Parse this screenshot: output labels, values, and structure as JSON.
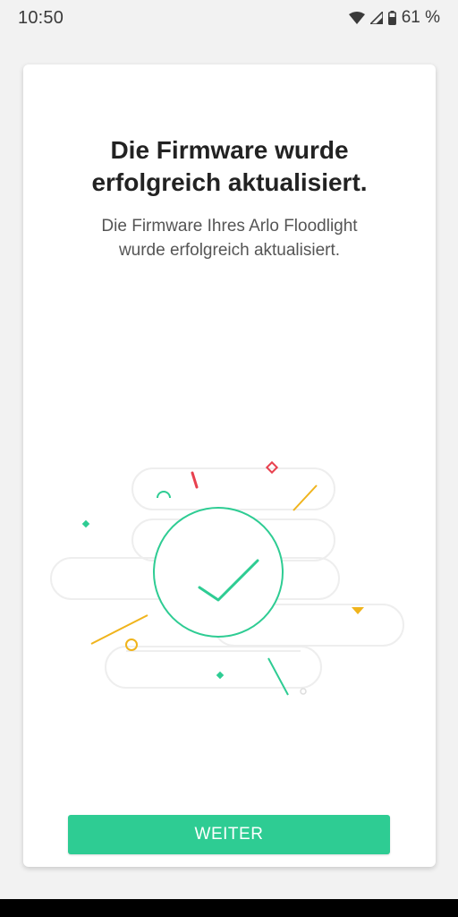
{
  "status_bar": {
    "time": "10:50",
    "battery_percent": "61 %",
    "icons": [
      "wifi-icon",
      "cell-signal-icon",
      "battery-icon"
    ]
  },
  "dialog": {
    "title": "Die Firmware wurde\nerfolgreich aktualisiert.",
    "message": "Die Firmware Ihres Arlo Floodlight\nwurde erfolgreich aktualisiert.",
    "illustration_icon": "checkmark-success-icon",
    "button_label": "WEITER"
  },
  "colors": {
    "accent": "#2ecc93",
    "confetti_red": "#e8414f",
    "confetti_yellow": "#f0b41c",
    "confetti_teal": "#2ecc93"
  }
}
